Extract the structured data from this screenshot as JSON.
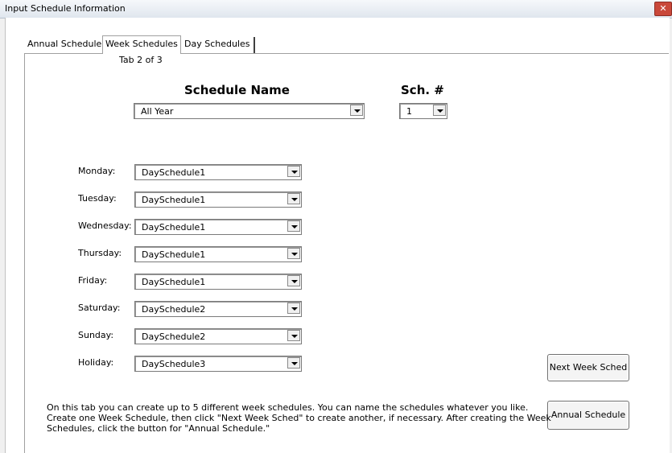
{
  "window": {
    "title": "Input Schedule Information",
    "close_glyph": "✕"
  },
  "tabs": [
    {
      "label": "Annual Schedule"
    },
    {
      "label": "Week Schedules",
      "selected": true
    },
    {
      "label": "Day Schedules"
    }
  ],
  "tab_caption": "Tab 2 of 3",
  "schedule": {
    "name_header": "Schedule Name",
    "name_value": "All Year",
    "num_header": "Sch. #",
    "num_value": "1"
  },
  "days": [
    {
      "label": "Monday:",
      "value": "DaySchedule1"
    },
    {
      "label": "Tuesday:",
      "value": "DaySchedule1"
    },
    {
      "label": "Wednesday:",
      "value": "DaySchedule1"
    },
    {
      "label": "Thursday:",
      "value": "DaySchedule1"
    },
    {
      "label": "Friday:",
      "value": "DaySchedule1"
    },
    {
      "label": "Saturday:",
      "value": "DaySchedule2"
    },
    {
      "label": "Sunday:",
      "value": "DaySchedule2"
    },
    {
      "label": "Holiday:",
      "value": "DaySchedule3"
    }
  ],
  "buttons": {
    "next_week": "Next Week Sched",
    "annual": "Annual Schedule"
  },
  "help_lines": [
    "On this tab you can create up to 5 different week schedules.  You can name the schedules whatever you like.",
    "Create one Week Schedule, then click \"Next Week Sched\" to create another, if necessary.  After creating the Week",
    "Schedules, click the button for \"Annual Schedule.\""
  ]
}
